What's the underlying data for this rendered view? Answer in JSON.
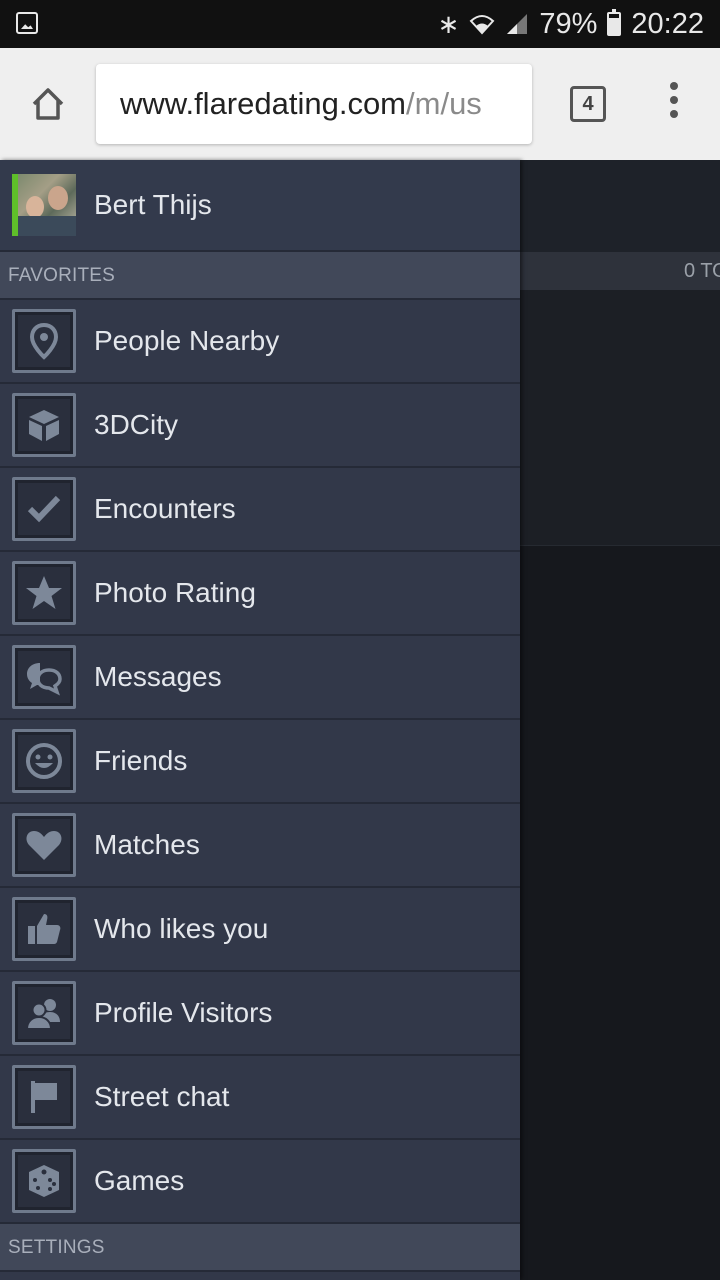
{
  "status_bar": {
    "battery_percent": "79%",
    "battery_level": 0.79,
    "time": "20:22"
  },
  "browser": {
    "url_main": "www.flaredating.com",
    "url_rest": "/m/us",
    "tab_count": "4"
  },
  "background": {
    "strip_text": "0 TO"
  },
  "drawer": {
    "profile": {
      "name": "Bert Thijs"
    },
    "sections": {
      "favorites": "FAVORITES",
      "settings": "SETTINGS"
    },
    "items": [
      {
        "label": "People Nearby",
        "icon": "location-pin-icon"
      },
      {
        "label": "3DCity",
        "icon": "cube-icon"
      },
      {
        "label": "Encounters",
        "icon": "checkbox-icon"
      },
      {
        "label": "Photo Rating",
        "icon": "star-icon"
      },
      {
        "label": "Messages",
        "icon": "chat-bubbles-icon"
      },
      {
        "label": "Friends",
        "icon": "smiley-icon"
      },
      {
        "label": "Matches",
        "icon": "heart-icon"
      },
      {
        "label": "Who likes you",
        "icon": "thumbs-up-icon"
      },
      {
        "label": "Profile Visitors",
        "icon": "users-icon"
      },
      {
        "label": "Street chat",
        "icon": "flag-icon"
      },
      {
        "label": "Games",
        "icon": "dice-icon"
      }
    ]
  },
  "colors": {
    "drawer_bg": "#323849",
    "section_bg": "#414859",
    "icon_fill": "#7d8899",
    "online_indicator": "#5fbf2a"
  }
}
